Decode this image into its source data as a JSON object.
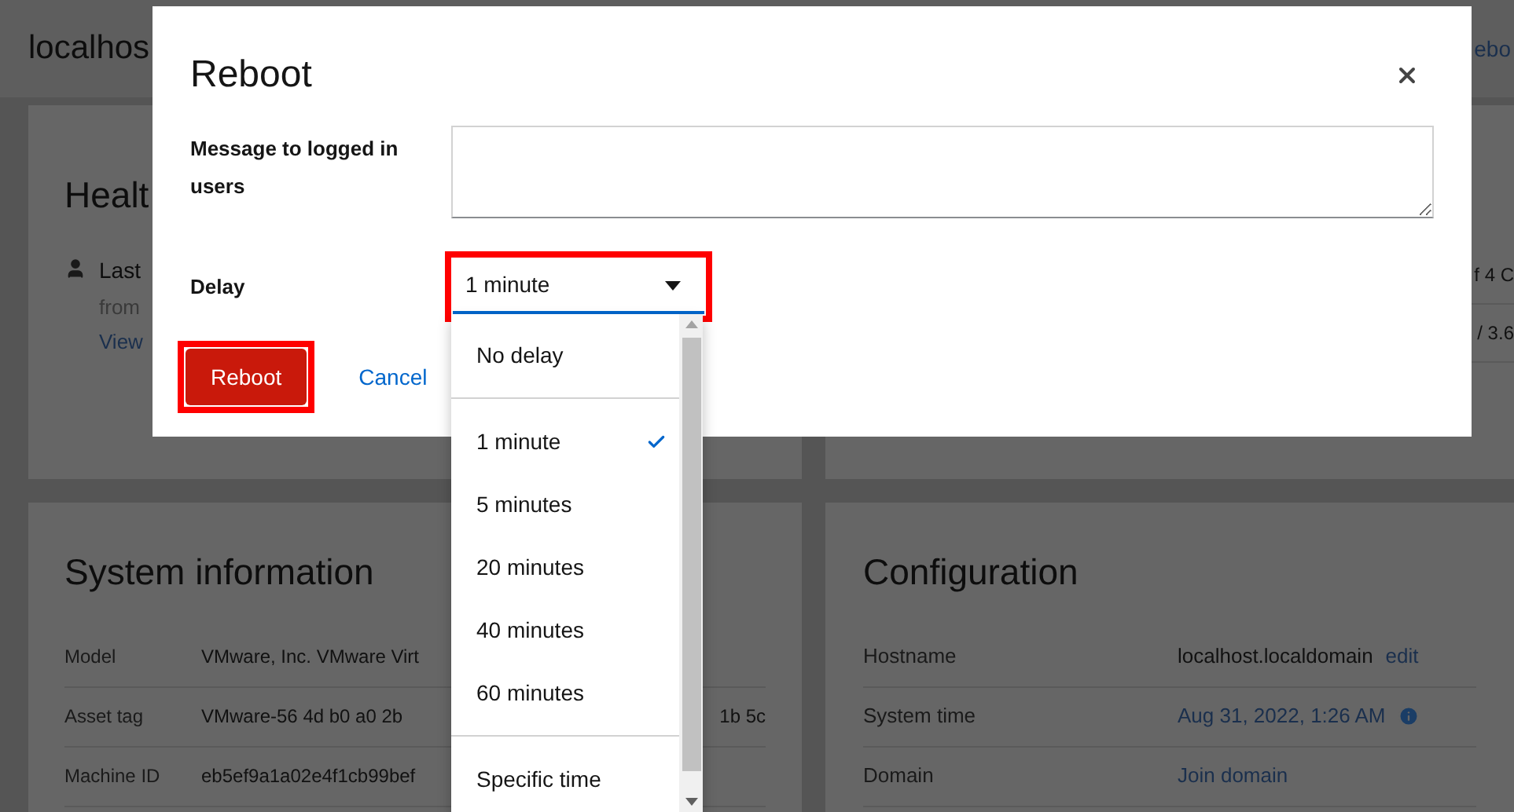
{
  "page": {
    "host_title": "localhos",
    "header_action": "ebo"
  },
  "health_card": {
    "title": "Healt",
    "login_line": "Last",
    "from_line": "from",
    "view_link": "View"
  },
  "usage_card": {
    "rows": [
      "f 4 C",
      "/ 3.6"
    ]
  },
  "system_info": {
    "title": "System information",
    "rows": [
      {
        "label": "Model",
        "value": "VMware, Inc. VMware Virt"
      },
      {
        "label": "Asset tag",
        "value": "VMware-56 4d b0 a0 2b",
        "value_end": "1b 5c"
      },
      {
        "label": "Machine ID",
        "value": "eb5ef9a1a02e4f1cb99bef"
      }
    ]
  },
  "configuration": {
    "title": "Configuration",
    "rows": [
      {
        "label": "Hostname",
        "kind": "value_with_action",
        "value": "localhost.localdomain",
        "action": "edit"
      },
      {
        "label": "System time",
        "kind": "link_with_info",
        "value": "Aug 31, 2022, 1:26 AM"
      },
      {
        "label": "Domain",
        "kind": "link",
        "value": "Join domain"
      }
    ]
  },
  "dialog": {
    "title": "Reboot",
    "message_label": "Message to logged in users",
    "delay_label": "Delay",
    "delay_select": {
      "value": "1 minute",
      "highlighted": true
    },
    "delay_menu": {
      "groups": [
        {
          "options": [
            {
              "label": "No delay",
              "selected": false
            }
          ]
        },
        {
          "options": [
            {
              "label": "1 minute",
              "selected": true
            },
            {
              "label": "5 minutes",
              "selected": false
            },
            {
              "label": "20 minutes",
              "selected": false
            },
            {
              "label": "40 minutes",
              "selected": false
            },
            {
              "label": "60 minutes",
              "selected": false
            }
          ]
        },
        {
          "options": [
            {
              "label": "Specific time",
              "selected": false
            }
          ]
        }
      ]
    },
    "buttons": [
      {
        "label": "Reboot",
        "kind": "primary",
        "highlighted": true
      },
      {
        "label": "Cancel",
        "kind": "link",
        "highlighted": false
      }
    ]
  }
}
